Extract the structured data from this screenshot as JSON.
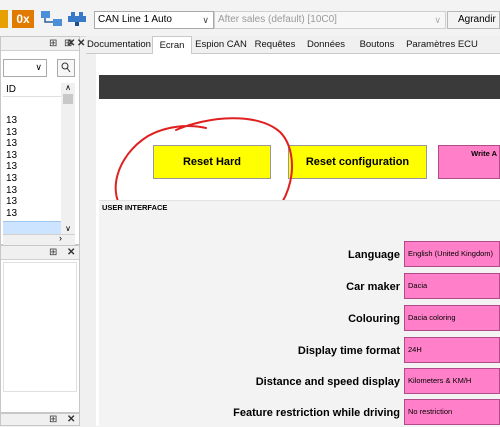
{
  "toolbar": {
    "hex_icon_label": "0x",
    "can_line_combo": "CAN Line 1 Auto",
    "session_combo": "After sales (default) [10C0]",
    "enlarge_button": "Agrandir"
  },
  "left_panel": {
    "column_header": "ID",
    "id_values": [
      "13",
      "13",
      "13",
      "13",
      "13",
      "13",
      "13",
      "13",
      "13"
    ]
  },
  "tabs": [
    "Documentation",
    "Ecran",
    "Espion CAN",
    "Requêtes",
    "Données",
    "Boutons",
    "Paramètres ECU"
  ],
  "active_tab": "Ecran",
  "buttons": {
    "reset_hard": "Reset Hard",
    "reset_configuration": "Reset configuration",
    "write": "Write A"
  },
  "section_title": "USER INTERFACE",
  "settings": [
    {
      "label": "Language",
      "value": "English (United Kingdom)"
    },
    {
      "label": "Car maker",
      "value": "Dacia"
    },
    {
      "label": "Colouring",
      "value": "Dacia coloring"
    },
    {
      "label": "Display time format",
      "value": "24H"
    },
    {
      "label": "Distance and speed display",
      "value": "Kilometers & KM/H"
    },
    {
      "label": "Feature restriction while driving",
      "value": "No restriction"
    }
  ],
  "colors": {
    "button_yellow": "#ffff00",
    "value_pink": "#ff80c8",
    "annotation_red": "#e02020",
    "header_bar": "#3a3a3a"
  }
}
